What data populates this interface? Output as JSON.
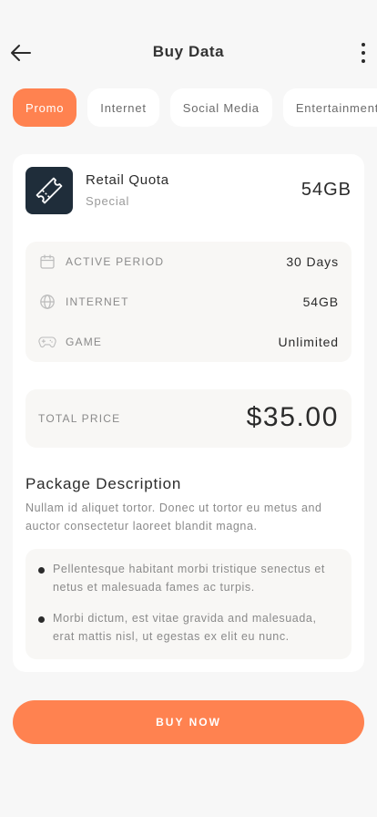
{
  "header": {
    "title": "Buy Data",
    "back_icon": "arrow-left-icon",
    "menu_icon": "more-vertical-icon"
  },
  "tabs": [
    {
      "label": "Promo",
      "active": true
    },
    {
      "label": "Internet",
      "active": false
    },
    {
      "label": "Social Media",
      "active": false
    },
    {
      "label": "Entertainment",
      "active": false
    }
  ],
  "product": {
    "icon": "ticket-icon",
    "name": "Retail Quota",
    "subtitle": "Special",
    "amount": "54GB"
  },
  "details": [
    {
      "icon": "calendar-icon",
      "label": "ACTIVE PERIOD",
      "value": "30 Days"
    },
    {
      "icon": "globe-icon",
      "label": "INTERNET",
      "value": "54GB"
    },
    {
      "icon": "gamepad-icon",
      "label": "GAME",
      "value": "Unlimited"
    }
  ],
  "total": {
    "label": "TOTAL PRICE",
    "value": "$35.00"
  },
  "description": {
    "title": "Package Description",
    "text": "Nullam id aliquet tortor. Donec ut tortor eu metus and auctor consectetur laoreet blandit magna.",
    "bullets": [
      "Pellentesque habitant morbi tristique senectus et netus et malesuada fames ac turpis.",
      "Morbi dictum, est vitae gravida and malesuada, erat mattis nisl, ut egestas ex elit eu nunc."
    ]
  },
  "buy_button": {
    "label": "BUY NOW"
  },
  "colors": {
    "accent": "#ff8250",
    "icon_bg": "#1f2d3a",
    "background": "#f7f7f7"
  }
}
